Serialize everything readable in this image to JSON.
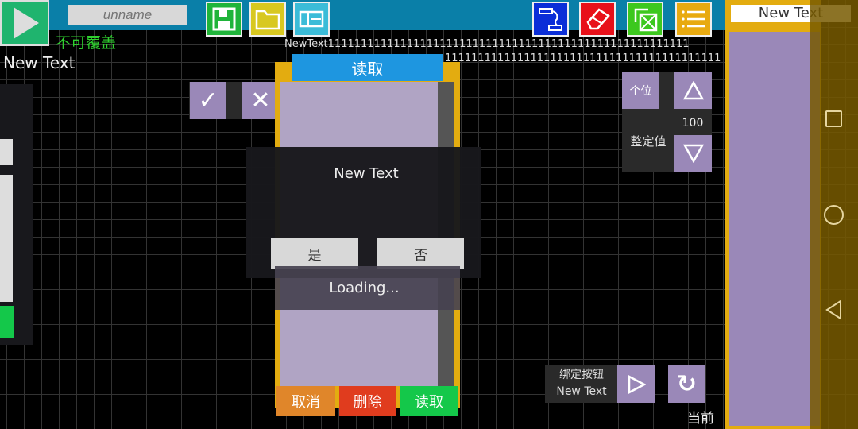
{
  "toolbar": {
    "name_placeholder": "unname",
    "overwrite_label": "不可覆盖"
  },
  "left_label": "New Text",
  "ones_line1": "NewText1111111111111111111111111111111111111111111111111111111",
  "ones_line2": "111111111111111111111111111111111111111111",
  "panel": {
    "title": "读取",
    "cancel": "取消",
    "delete": "删除",
    "read": "读取"
  },
  "dialog": {
    "message": "New Text",
    "yes": "是",
    "no": "否",
    "loading": "Loading..."
  },
  "stepper": {
    "unit_label": "个位",
    "value": "100",
    "label": "整定值"
  },
  "bind": {
    "label": "绑定按钮",
    "value": "New Text",
    "current": "当前"
  },
  "right_panel": {
    "title": "New Text"
  },
  "colors": {
    "topbar": "#0a7fa8",
    "accent": "#e3ac10",
    "purple": "#9a88b8"
  }
}
